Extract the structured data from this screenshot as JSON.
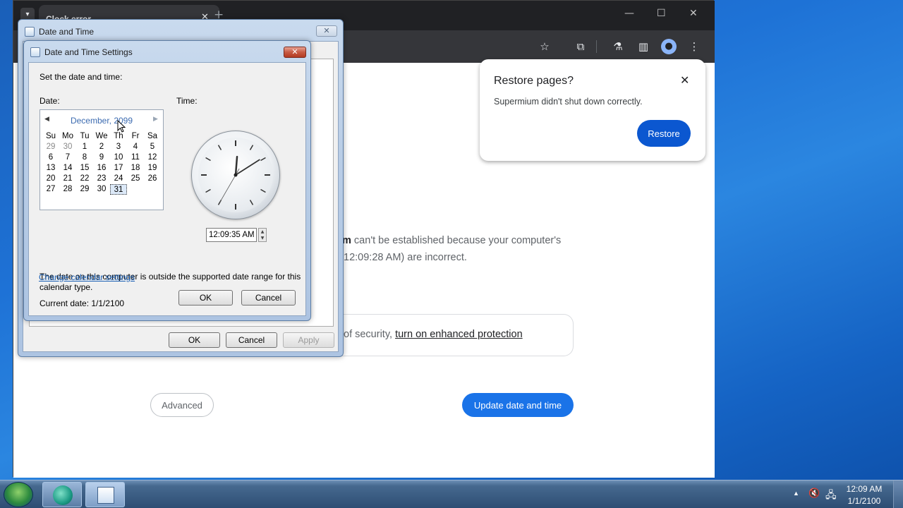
{
  "browser": {
    "tab_title": "Clock error",
    "tab_close": "✕",
    "new_tab": "+",
    "window_controls": [
      "—",
      "☐",
      "✕"
    ],
    "toolbar_icons": [
      "star-icon",
      "extensions-icon",
      "labs-icon",
      "sidepanel-icon",
      "profile-icon",
      "menu-icon"
    ],
    "toolbar_glyphs": {
      "star": "☆",
      "extensions": "⧉",
      "labs": "⚗",
      "sidepanel": "▥",
      "profile": "●",
      "menu": "⋮"
    }
  },
  "error_page": {
    "line1_bold": "m",
    "line1_rest": " can't be established because your computer's",
    "line2": "12:09:28 AM) are incorrect.",
    "security_text": "of security, ",
    "security_link": "turn on enhanced protection",
    "advanced_label": "Advanced",
    "update_label": "Update date and time"
  },
  "restore_popup": {
    "title": "Restore pages?",
    "message": "Supermium didn't shut down correctly.",
    "close": "✕",
    "button": "Restore"
  },
  "date_time_dialog": {
    "title": "Date and Time",
    "close": "✕",
    "ok": "OK",
    "cancel": "Cancel",
    "apply": "Apply"
  },
  "settings_dialog": {
    "title": "Date and Time Settings",
    "close": "✕",
    "intro": "Set the date and time:",
    "date_label": "Date:",
    "time_label": "Time:",
    "calendar_month": "December, 2099",
    "prev": "◀",
    "next": "▶",
    "weekdays": [
      "Su",
      "Mo",
      "Tu",
      "We",
      "Th",
      "Fr",
      "Sa"
    ],
    "weeks": [
      [
        "29",
        "30",
        "1",
        "2",
        "3",
        "4",
        "5"
      ],
      [
        "6",
        "7",
        "8",
        "9",
        "10",
        "11",
        "12"
      ],
      [
        "13",
        "14",
        "15",
        "16",
        "17",
        "18",
        "19"
      ],
      [
        "20",
        "21",
        "22",
        "23",
        "24",
        "25",
        "26"
      ],
      [
        "27",
        "28",
        "29",
        "30",
        "31",
        "",
        ""
      ]
    ],
    "selected_day": "31",
    "clock_time": {
      "hour": 0,
      "minute": 9,
      "second": 35
    },
    "time_value": "12:09:35 AM",
    "warning": "The date on this computer is outside the supported date range for this calendar type.",
    "current_date": "Current date: 1/1/2100",
    "change_link": "Change calendar settings",
    "ok": "OK",
    "cancel": "Cancel"
  },
  "taskbar": {
    "time": "12:09 AM",
    "date": "1/1/2100",
    "tray_icons": [
      "show-hidden-icon",
      "volume-muted-icon",
      "network-icon"
    ],
    "tray_glyphs": {
      "show_hidden": "▲",
      "volume": "🔇",
      "network": "🖧"
    }
  }
}
